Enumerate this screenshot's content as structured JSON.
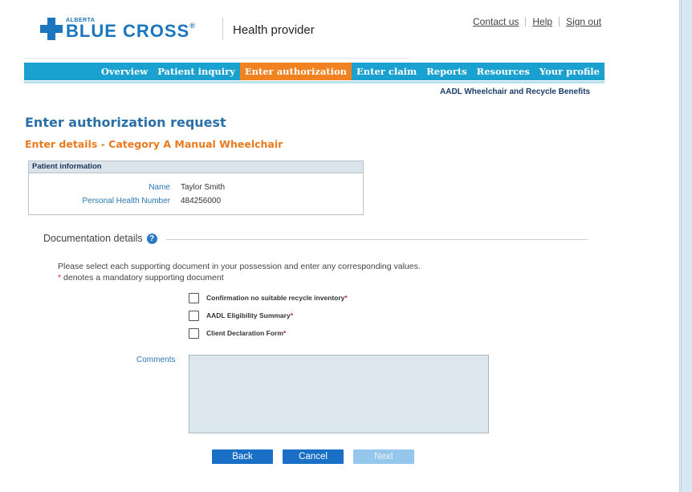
{
  "header": {
    "logo_small": "ALBERTA",
    "logo_big": "BLUE CROSS",
    "logo_reg": "®",
    "app_title": "Health provider",
    "links": [
      "Contact us",
      "Help",
      "Sign out"
    ]
  },
  "nav": {
    "items": [
      "Overview",
      "Patient inquiry",
      "Enter authorization",
      "Enter claim",
      "Reports",
      "Resources",
      "Your profile"
    ],
    "active_index": 2
  },
  "program": "AADL Wheelchair and Recycle Benefits",
  "page": {
    "title": "Enter authorization request",
    "subtitle": "Enter details - Category A Manual Wheelchair"
  },
  "patient": {
    "heading": "Patient information",
    "name_label": "Name",
    "name_value": "Taylor Smith",
    "phn_label": "Personal Health Number",
    "phn_value": "484256000"
  },
  "documentation": {
    "heading": "Documentation details",
    "instruction": "Please select each supporting document in your possession and enter any corresponding values.",
    "mandatory_star": "*",
    "mandatory_note": " denotes a mandatory supporting document",
    "documents": [
      {
        "label": "Confirmation no suitable recycle inventory",
        "mandatory": "*",
        "checked": false
      },
      {
        "label": "AADL Eligibility Summary",
        "mandatory": "*",
        "checked": false
      },
      {
        "label": "Client Declaration Form",
        "mandatory": "*",
        "checked": false
      }
    ],
    "comments_label": "Comments",
    "comments_value": ""
  },
  "buttons": {
    "back": "Back",
    "cancel": "Cancel",
    "next": "Next"
  },
  "colors": {
    "brand_blue": "#1976bf",
    "nav_bg": "#1ba1cf",
    "nav_active": "#f18221",
    "title_blue": "#2a6fa6",
    "subtitle_orange": "#e97a1e",
    "button_blue": "#1a6fc6",
    "button_disabled": "#95c7ed"
  }
}
